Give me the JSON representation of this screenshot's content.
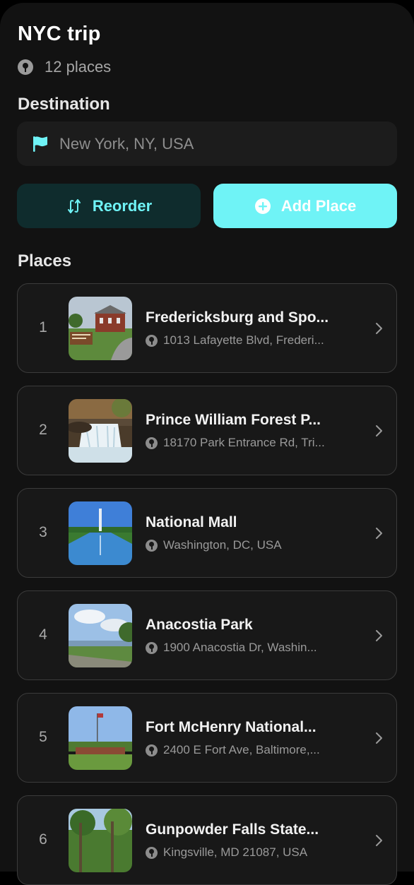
{
  "trip": {
    "title": "NYC trip",
    "count_label": "12 places"
  },
  "destination": {
    "label": "Destination",
    "value": "New York, NY, USA",
    "icon": "flag-icon"
  },
  "actions": {
    "reorder_label": "Reorder",
    "add_label": "Add Place"
  },
  "places": {
    "label": "Places",
    "items": [
      {
        "num": "1",
        "name": "Fredericksburg and Spo...",
        "address": "1013 Lafayette Blvd, Frederi..."
      },
      {
        "num": "2",
        "name": "Prince William Forest P...",
        "address": "18170 Park Entrance Rd, Tri..."
      },
      {
        "num": "3",
        "name": "National Mall",
        "address": "Washington, DC, USA"
      },
      {
        "num": "4",
        "name": "Anacostia Park",
        "address": "1900 Anacostia Dr, Washin..."
      },
      {
        "num": "5",
        "name": "Fort McHenry National...",
        "address": "2400 E Fort Ave, Baltimore,..."
      },
      {
        "num": "6",
        "name": "Gunpowder Falls State...",
        "address": "Kingsville, MD 21087, USA"
      }
    ]
  },
  "colors": {
    "accent": "#6ff3f6",
    "background": "#121212",
    "card": "#181818"
  }
}
